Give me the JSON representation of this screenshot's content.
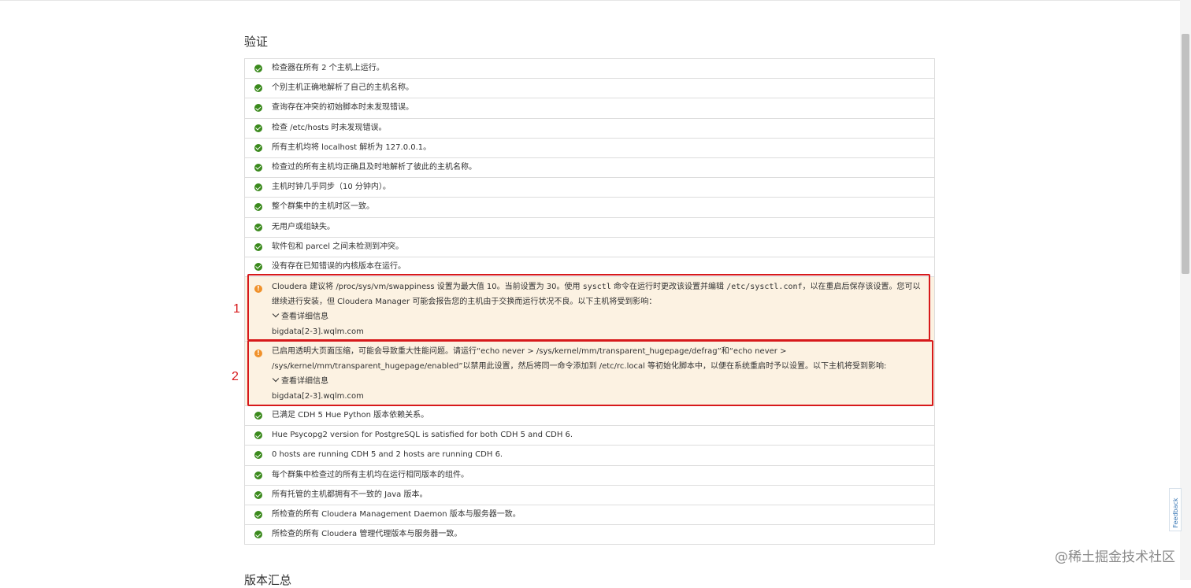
{
  "section_title": "验证",
  "next_section_title": "版本汇总",
  "checks_before": [
    "检查器在所有 2 个主机上运行。",
    "个别主机正确地解析了自己的主机名称。",
    "查询存在冲突的初始脚本时未发现错误。",
    "检查 /etc/hosts 时未发现错误。",
    "所有主机均将 localhost 解析为 127.0.0.1。",
    "检查过的所有主机均正确且及时地解析了彼此的主机名称。",
    "主机时钟几乎同步（10 分钟内）。",
    "整个群集中的主机时区一致。",
    "无用户或组缺失。",
    "软件包和 parcel 之间未检测到冲突。",
    "没有存在已知错误的内核版本在运行。"
  ],
  "warning1": {
    "text_a": "Cloudera 建议将 /proc/sys/vm/swappiness 设置为最大值 10。当前设置为 30。使用 ",
    "code_a": "sysctl",
    "text_b": " 命令在运行时更改该设置并编辑 ",
    "code_b": "/etc/sysctl.conf",
    "text_c": "，以在重启后保存该设置。您可以继续进行安装，但 Cloudera Manager 可能会报告您的主机由于交换而运行状况不良。以下主机将受到影响：",
    "details_label": "查看详细信息",
    "host": "bigdata[2-3].wqlm.com"
  },
  "warning2": {
    "text": "已启用透明大页面压缩，可能会导致重大性能问题。请运行“echo never > /sys/kernel/mm/transparent_hugepage/defrag”和“echo never > /sys/kernel/mm/transparent_hugepage/enabled”以禁用此设置，然后将同一命令添加到 /etc/rc.local 等初始化脚本中，以便在系统重启时予以设置。以下主机将受到影响:",
    "details_label": "查看详细信息",
    "host": "bigdata[2-3].wqlm.com"
  },
  "checks_after": [
    "已满足 CDH 5 Hue Python 版本依赖关系。",
    "Hue Psycopg2 version for PostgreSQL is satisfied for both CDH 5 and CDH 6.",
    "0 hosts are running CDH 5 and 2 hosts are running CDH 6.",
    "每个群集中检查过的所有主机均在运行相同版本的组件。",
    "所有托管的主机都拥有不一致的 Java 版本。",
    "所检查的所有 Cloudera Management Daemon 版本与服务器一致。",
    "所检查的所有 Cloudera 管理代理版本与服务器一致。"
  ],
  "annotations": [
    "1",
    "2"
  ],
  "feedback_label": "Feedback",
  "watermark": "@稀土掘金技术社区",
  "colors": {
    "ok": "#3b8a1d",
    "warn_icon": "#f0912a",
    "warn_bg": "#fcf2e2",
    "annotation": "#d7191b"
  }
}
